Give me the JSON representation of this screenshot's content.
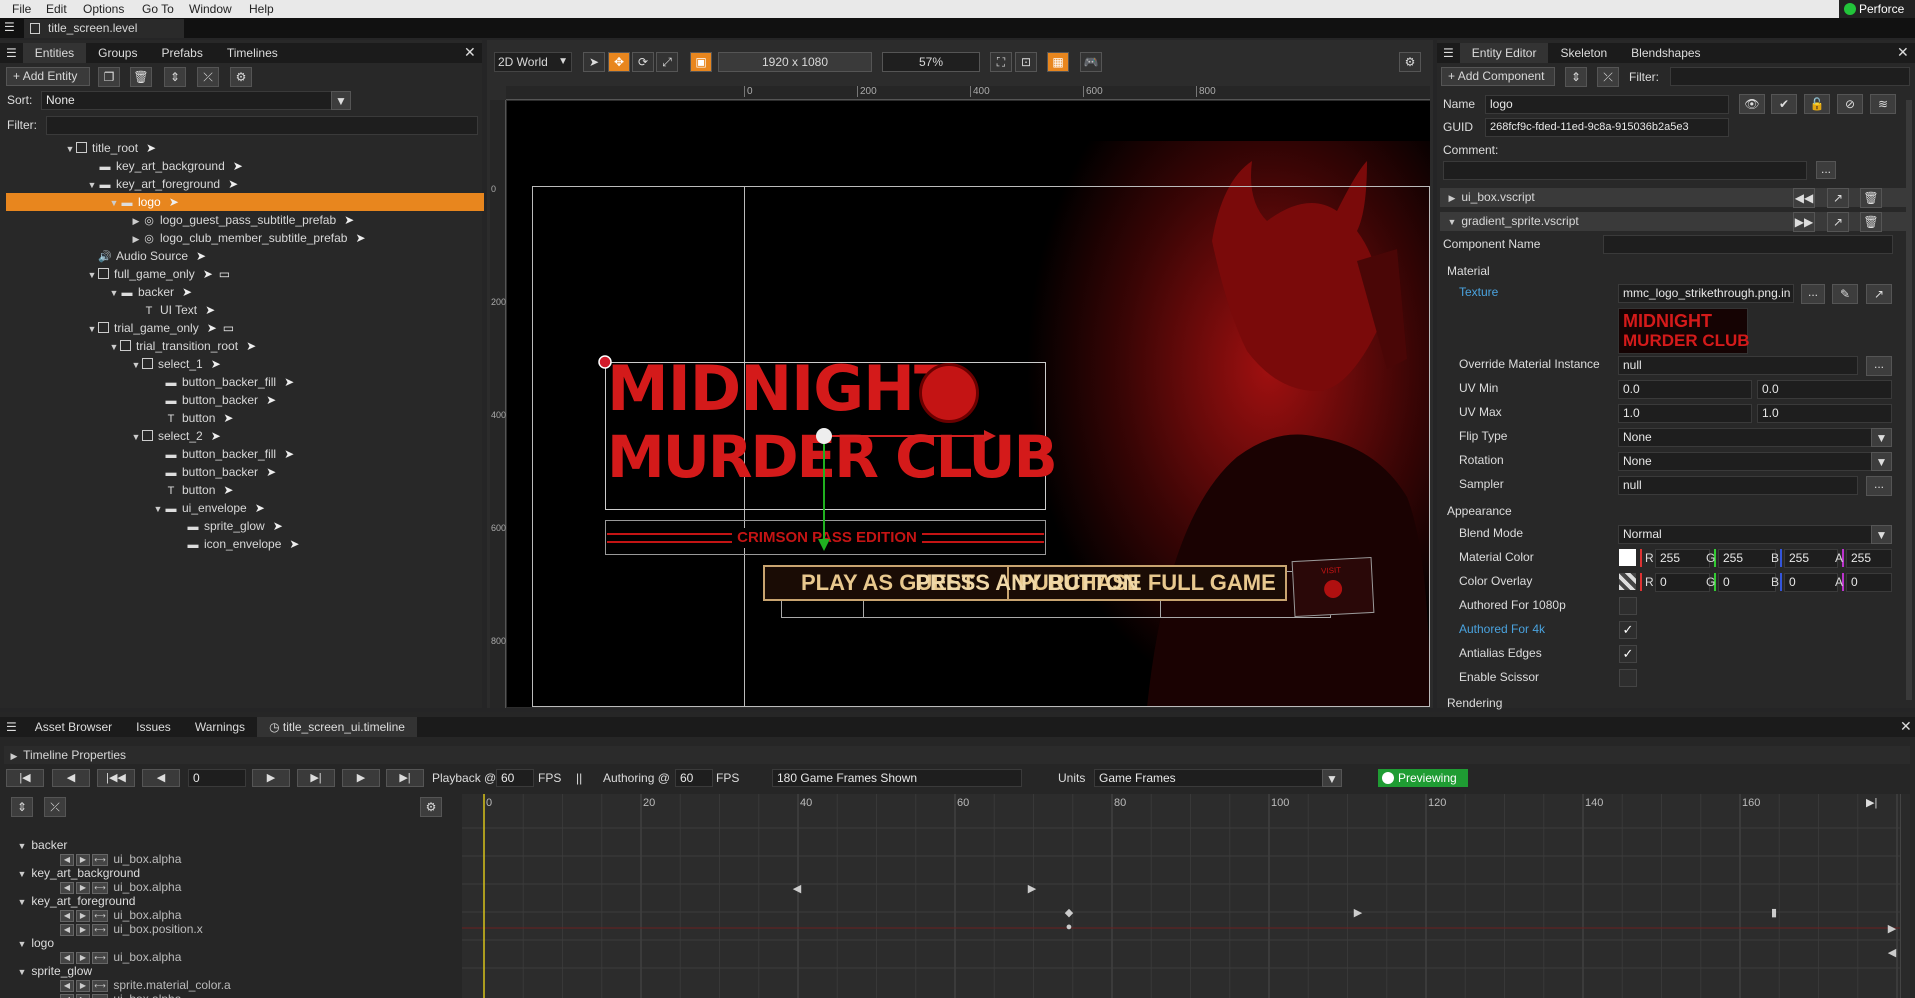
{
  "menubar": {
    "items": [
      "File",
      "Edit",
      "Options",
      "Go To",
      "Window",
      "Help"
    ],
    "perforce": "Perforce"
  },
  "doc_tab": {
    "title": "title_screen.level"
  },
  "left_panel": {
    "tabs": [
      "Entities",
      "Groups",
      "Prefabs",
      "Timelines"
    ],
    "add_entity": "Add Entity",
    "sort_label": "Sort:",
    "sort_value": "None",
    "filter_label": "Filter:",
    "tree": [
      {
        "label": "title_root",
        "kind": "check",
        "depth": 0,
        "expand": "open"
      },
      {
        "label": "key_art_background",
        "kind": "image",
        "depth": 1,
        "expand": "none"
      },
      {
        "label": "key_art_foreground",
        "kind": "image",
        "depth": 1,
        "expand": "open"
      },
      {
        "label": "logo",
        "kind": "image",
        "depth": 2,
        "expand": "open",
        "selected": true
      },
      {
        "label": "logo_guest_pass_subtitle_prefab",
        "kind": "prefab",
        "depth": 3,
        "expand": "closed"
      },
      {
        "label": "logo_club_member_subtitle_prefab",
        "kind": "prefab",
        "depth": 3,
        "expand": "closed"
      },
      {
        "label": "Audio Source",
        "kind": "audio",
        "depth": 1,
        "expand": "none"
      },
      {
        "label": "full_game_only",
        "kind": "check",
        "depth": 1,
        "expand": "open",
        "comment": true
      },
      {
        "label": "backer",
        "kind": "image",
        "depth": 2,
        "expand": "open"
      },
      {
        "label": "UI Text",
        "kind": "text",
        "depth": 3,
        "expand": "none"
      },
      {
        "label": "trial_game_only",
        "kind": "check",
        "depth": 1,
        "expand": "open",
        "comment": true
      },
      {
        "label": "trial_transition_root",
        "kind": "check",
        "depth": 2,
        "expand": "open"
      },
      {
        "label": "select_1",
        "kind": "check",
        "depth": 3,
        "expand": "open"
      },
      {
        "label": "button_backer_fill",
        "kind": "image",
        "depth": 4,
        "expand": "none"
      },
      {
        "label": "button_backer",
        "kind": "image",
        "depth": 4,
        "expand": "none"
      },
      {
        "label": "button",
        "kind": "text",
        "depth": 4,
        "expand": "none"
      },
      {
        "label": "select_2",
        "kind": "check",
        "depth": 3,
        "expand": "open"
      },
      {
        "label": "button_backer_fill",
        "kind": "image",
        "depth": 4,
        "expand": "none"
      },
      {
        "label": "button_backer",
        "kind": "image",
        "depth": 4,
        "expand": "none"
      },
      {
        "label": "button",
        "kind": "text",
        "depth": 4,
        "expand": "none"
      },
      {
        "label": "ui_envelope",
        "kind": "image",
        "depth": 4,
        "expand": "open"
      },
      {
        "label": "sprite_glow",
        "kind": "image",
        "depth": 5,
        "expand": "none"
      },
      {
        "label": "icon_envelope",
        "kind": "image",
        "depth": 5,
        "expand": "none"
      }
    ]
  },
  "viewport": {
    "world": "2D World",
    "resolution": "1920 x 1080",
    "zoom": "57%",
    "ruler_h": [
      "0",
      "200",
      "400",
      "600",
      "800"
    ],
    "ruler_v": [
      "0",
      "200",
      "400",
      "600",
      "800"
    ],
    "logo_line1": "MIDNIGHT",
    "logo_line2": "MURDER CLUB",
    "subtitle": "CRIMSON PASS EDITION",
    "button1": "PLAY AS GUEST",
    "button_overlap": "PRESS ANY BUTTON",
    "button2": "PURCHASE FULL GAME",
    "envelope_text": "VISIT"
  },
  "entity_editor": {
    "tabs": [
      "Entity Editor",
      "Skeleton",
      "Blendshapes"
    ],
    "add_component": "Add Component",
    "filter_label": "Filter:",
    "name_label": "Name",
    "name_value": "logo",
    "guid_label": "GUID",
    "guid_value": "268fcf9c-fded-11ed-9c8a-915036b2a5e3",
    "comment_label": "Comment:",
    "components": [
      "ui_box.vscript",
      "gradient_sprite.vscript"
    ],
    "component_name_label": "Component Name",
    "material_header": "Material",
    "texture_label": "Texture",
    "texture_value": "mmc_logo_strikethrough.png.in",
    "thumb_line1": "MIDNIGHT",
    "thumb_line2": "MURDER CLUB",
    "override_label": "Override Material Instance",
    "override_value": "null",
    "uvmin_label": "UV Min",
    "uvmin": [
      "0.0",
      "0.0"
    ],
    "uvmax_label": "UV Max",
    "uvmax": [
      "1.0",
      "1.0"
    ],
    "flip_label": "Flip Type",
    "flip_value": "None",
    "rotation_label": "Rotation",
    "rotation_value": "None",
    "sampler_label": "Sampler",
    "sampler_value": "null",
    "appearance_header": "Appearance",
    "blend_label": "Blend Mode",
    "blend_value": "Normal",
    "matcolor_label": "Material Color",
    "matcolor": {
      "r": "255",
      "g": "255",
      "b": "255",
      "a": "255"
    },
    "overlay_label": "Color Overlay",
    "overlay": {
      "r": "0",
      "g": "0",
      "b": "0",
      "a": "0"
    },
    "channel_letters": {
      "r": "R",
      "g": "G",
      "b": "B",
      "a": "A"
    },
    "authored1080_label": "Authored For 1080p",
    "authored4k_label": "Authored For 4k",
    "antialias_label": "Antialias Edges",
    "scissor_label": "Enable Scissor",
    "rendering_header": "Rendering",
    "checks": {
      "authored1080": false,
      "authored4k": true,
      "antialias": true,
      "scissor": false
    },
    "accent_blue": "#4aa3df"
  },
  "bottom": {
    "tabs": [
      "Asset Browser",
      "Issues",
      "Warnings",
      "title_screen_ui.timeline"
    ],
    "timeline_props": "Timeline Properties",
    "frame_value": "0",
    "playback_label": "Playback @",
    "playback_fps": "60",
    "fps_label": "FPS",
    "sep": "||",
    "authoring_label": "Authoring @",
    "authoring_fps": "60",
    "fps_label2": "FPS",
    "frames_shown": "180 Game Frames Shown",
    "units_label": "Units",
    "units_value": "Game Frames",
    "previewing": "Previewing",
    "ruler": [
      "0",
      "20",
      "40",
      "60",
      "80",
      "100",
      "120",
      "140",
      "160"
    ],
    "tracks": [
      {
        "entity": "backer",
        "props": [
          "ui_box.alpha"
        ]
      },
      {
        "entity": "key_art_background",
        "props": [
          "ui_box.alpha"
        ]
      },
      {
        "entity": "key_art_foreground",
        "props": [
          "ui_box.alpha",
          "ui_box.position.x"
        ]
      },
      {
        "entity": "logo",
        "props": [
          "ui_box.alpha"
        ]
      },
      {
        "entity": "sprite_glow",
        "props": [
          "sprite.material_color.a",
          "ui_box.alpha"
        ]
      }
    ]
  }
}
